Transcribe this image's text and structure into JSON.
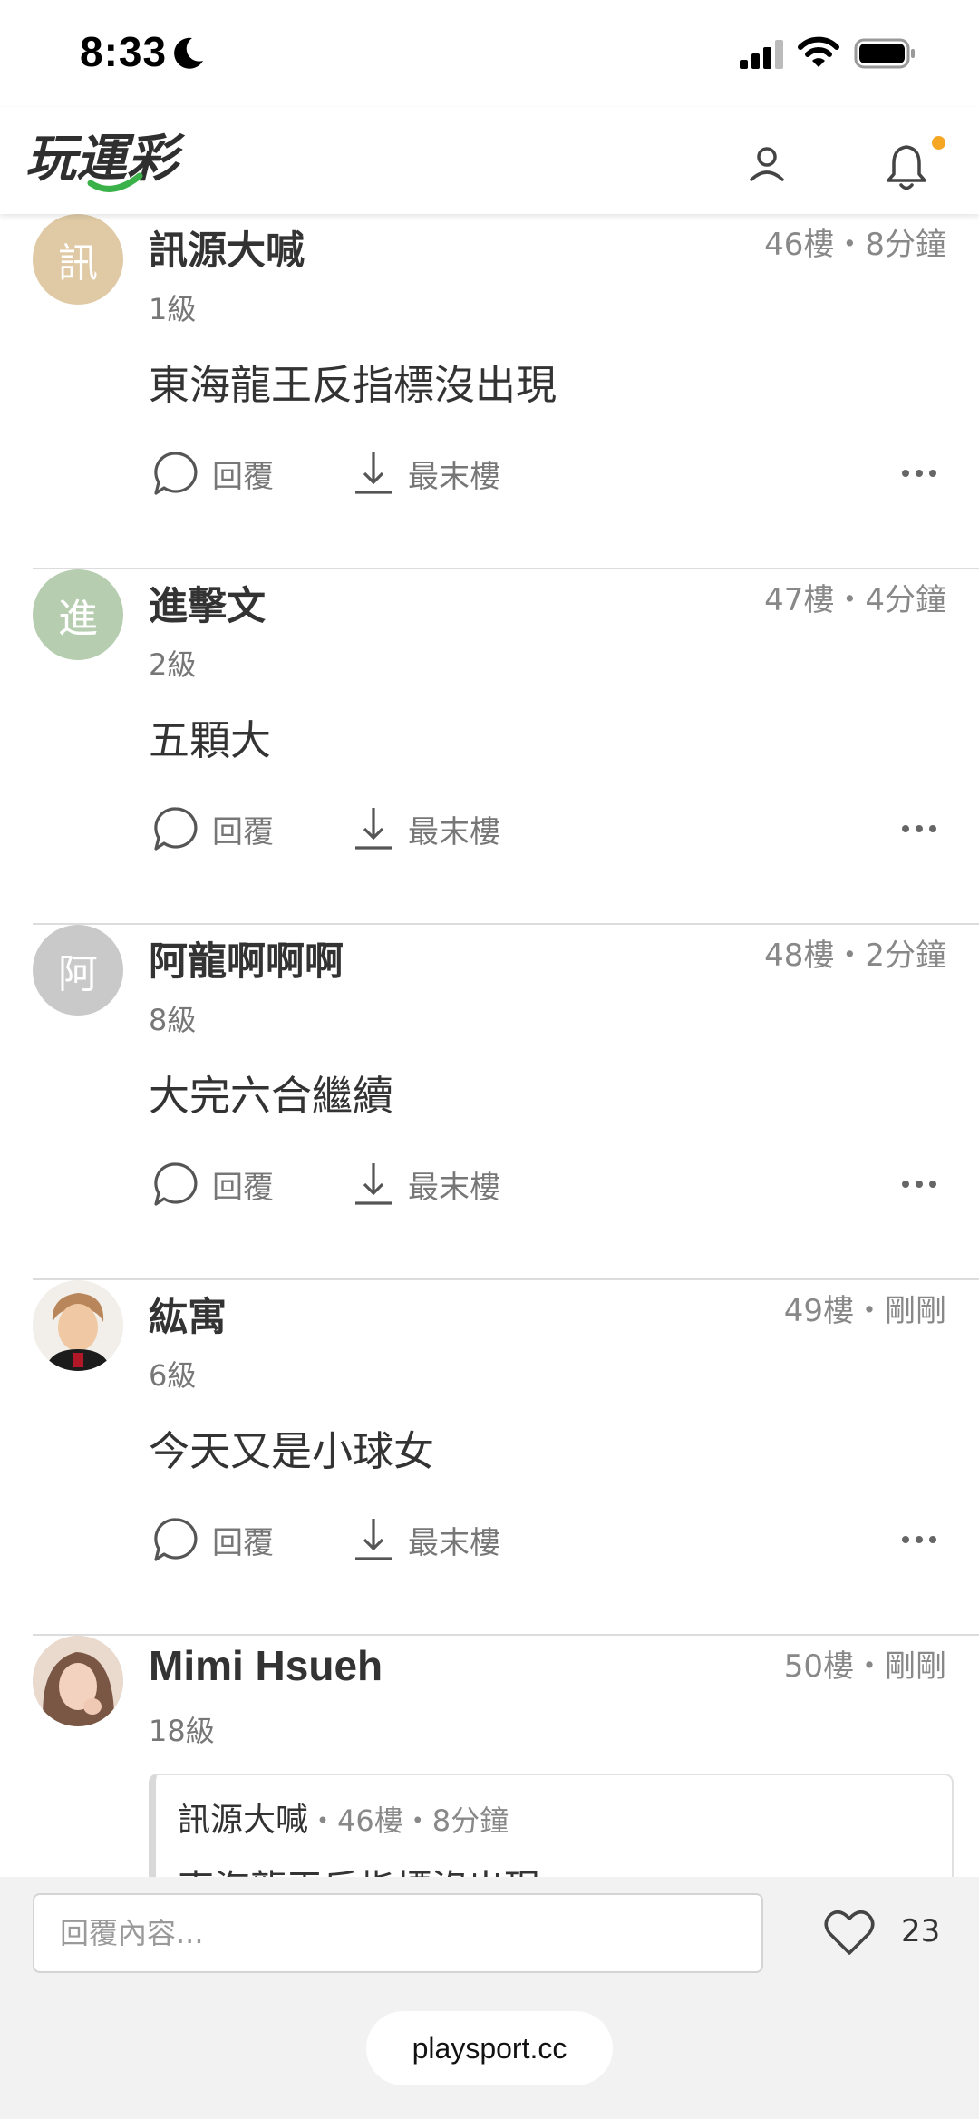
{
  "status_bar": {
    "time": "8:33"
  },
  "header": {
    "logo_text": "玩運彩",
    "notification_dot_color": "#f5a623"
  },
  "posts": [
    {
      "avatar_char": "訊",
      "avatar_color": "#e0caa5",
      "username": "訊源大喊",
      "level": "1級",
      "floor": "46樓・8分鐘",
      "content": "東海龍王反指標沒出現",
      "reply_label": "回覆",
      "last_floor_label": "最末樓"
    },
    {
      "avatar_char": "進",
      "avatar_color": "#b6cdb0",
      "username": "進擊文",
      "level": "2級",
      "floor": "47樓・4分鐘",
      "content": "五顆大",
      "reply_label": "回覆",
      "last_floor_label": "最末樓"
    },
    {
      "avatar_char": "阿",
      "avatar_color": "#c9c9c9",
      "username": "阿龍啊啊啊",
      "level": "8級",
      "floor": "48樓・2分鐘",
      "content": "大完六合繼續",
      "reply_label": "回覆",
      "last_floor_label": "最末樓"
    },
    {
      "avatar_char": "",
      "avatar_color": "",
      "username": "紘寓",
      "level": "6級",
      "floor": "49樓・剛剛",
      "content": "今天又是小球女",
      "reply_label": "回覆",
      "last_floor_label": "最末樓"
    },
    {
      "avatar_char": "",
      "avatar_color": "",
      "username": "Mimi Hsueh",
      "level": "18級",
      "floor": "50樓・剛剛",
      "quote": {
        "author": "訊源大喊",
        "meta": "・46樓・8分鐘",
        "text": "東海龍王反指標沒出現"
      }
    }
  ],
  "bottom_bar": {
    "reply_placeholder": "回覆內容...",
    "like_count": "23",
    "url": "playsport.cc"
  }
}
